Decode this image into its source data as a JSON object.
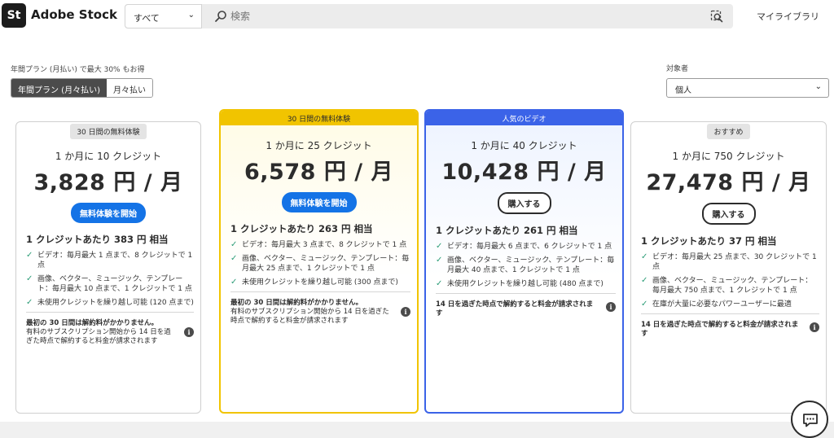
{
  "header": {
    "logo_text": "St",
    "brand": "Adobe Stock",
    "scope": "すべて",
    "search_placeholder": "検索",
    "my_library": "マイライブラリ"
  },
  "plan_toggle": {
    "note": "年間プラン (月払い) で最大 30% もお得",
    "options": [
      "年間プラン (月々払い)",
      "月々払い"
    ],
    "selected": "年間プラン (月々払い)"
  },
  "audience": {
    "label": "対象者",
    "value": "個人"
  },
  "cards": [
    {
      "badge": "30 日間の無料体験",
      "credits": "1 か月に 10 クレジット",
      "price": "3,828 円 / 月",
      "button": "無料体験を開始",
      "per_credit": "1 クレジットあたり 383 円 相当",
      "features": [
        "ビデオ：毎月最大 1 点まで、8 クレジットで 1 点",
        "画像、ベクター、ミュージック、テンプレート：毎月最大 10 点まで、1 クレジットで 1 点",
        "未使用クレジットを繰り越し可能 (120 点まで)"
      ],
      "note_bold": "最初の 30 日間は解約料がかかりません。",
      "note": "有料のサブスクリプション開始から 14 日を過ぎた時点で解約すると料金が請求されます"
    },
    {
      "badge": "30 日間の無料体験",
      "credits": "1 か月に 25 クレジット",
      "price": "6,578 円 / 月",
      "button": "無料体験を開始",
      "per_credit": "1 クレジットあたり 263 円 相当",
      "features": [
        "ビデオ：毎月最大 3 点まで、8 クレジットで 1 点",
        "画像、ベクター、ミュージック、テンプレート：毎月最大 25 点まで、1 クレジットで 1 点",
        "未使用クレジットを繰り越し可能 (300 点まで)"
      ],
      "note_bold": "最初の 30 日間は解約料がかかりません。",
      "note": "有料のサブスクリプション開始から 14 日を過ぎた時点で解約すると料金が請求されます"
    },
    {
      "badge": "人気のビデオ",
      "credits": "1 か月に 40 クレジット",
      "price": "10,428 円 / 月",
      "button": "購入する",
      "per_credit": "1 クレジットあたり 261 円 相当",
      "features": [
        "ビデオ：毎月最大 6 点まで、6 クレジットで 1 点",
        "画像、ベクター、ミュージック、テンプレート：毎月最大 40 点まで、1 クレジットで 1 点",
        "未使用クレジットを繰り越し可能 (480 点まで)"
      ],
      "note_bold": "14 日を過ぎた時点で解約すると料金が請求されます",
      "note": ""
    },
    {
      "badge": "おすすめ",
      "credits": "1 か月に 750 クレジット",
      "price": "27,478 円 / 月",
      "button": "購入する",
      "per_credit": "1 クレジットあたり 37 円 相当",
      "features": [
        "ビデオ：毎月最大 25 点まで、30 クレジットで 1 点",
        "画像、ベクター、ミュージック、テンプレート：毎月最大 750 点まで、1 クレジットで 1 点",
        "在庫が大量に必要なパワーユーザーに最適"
      ],
      "note_bold": "14 日を過ぎた時点で解約すると料金が請求されます",
      "note": ""
    }
  ],
  "colors": {
    "primary_blue": "#1473e6",
    "highlight_yellow": "#f1c400",
    "popular_blue": "#3b63e8",
    "check_green": "#2d9d78"
  }
}
